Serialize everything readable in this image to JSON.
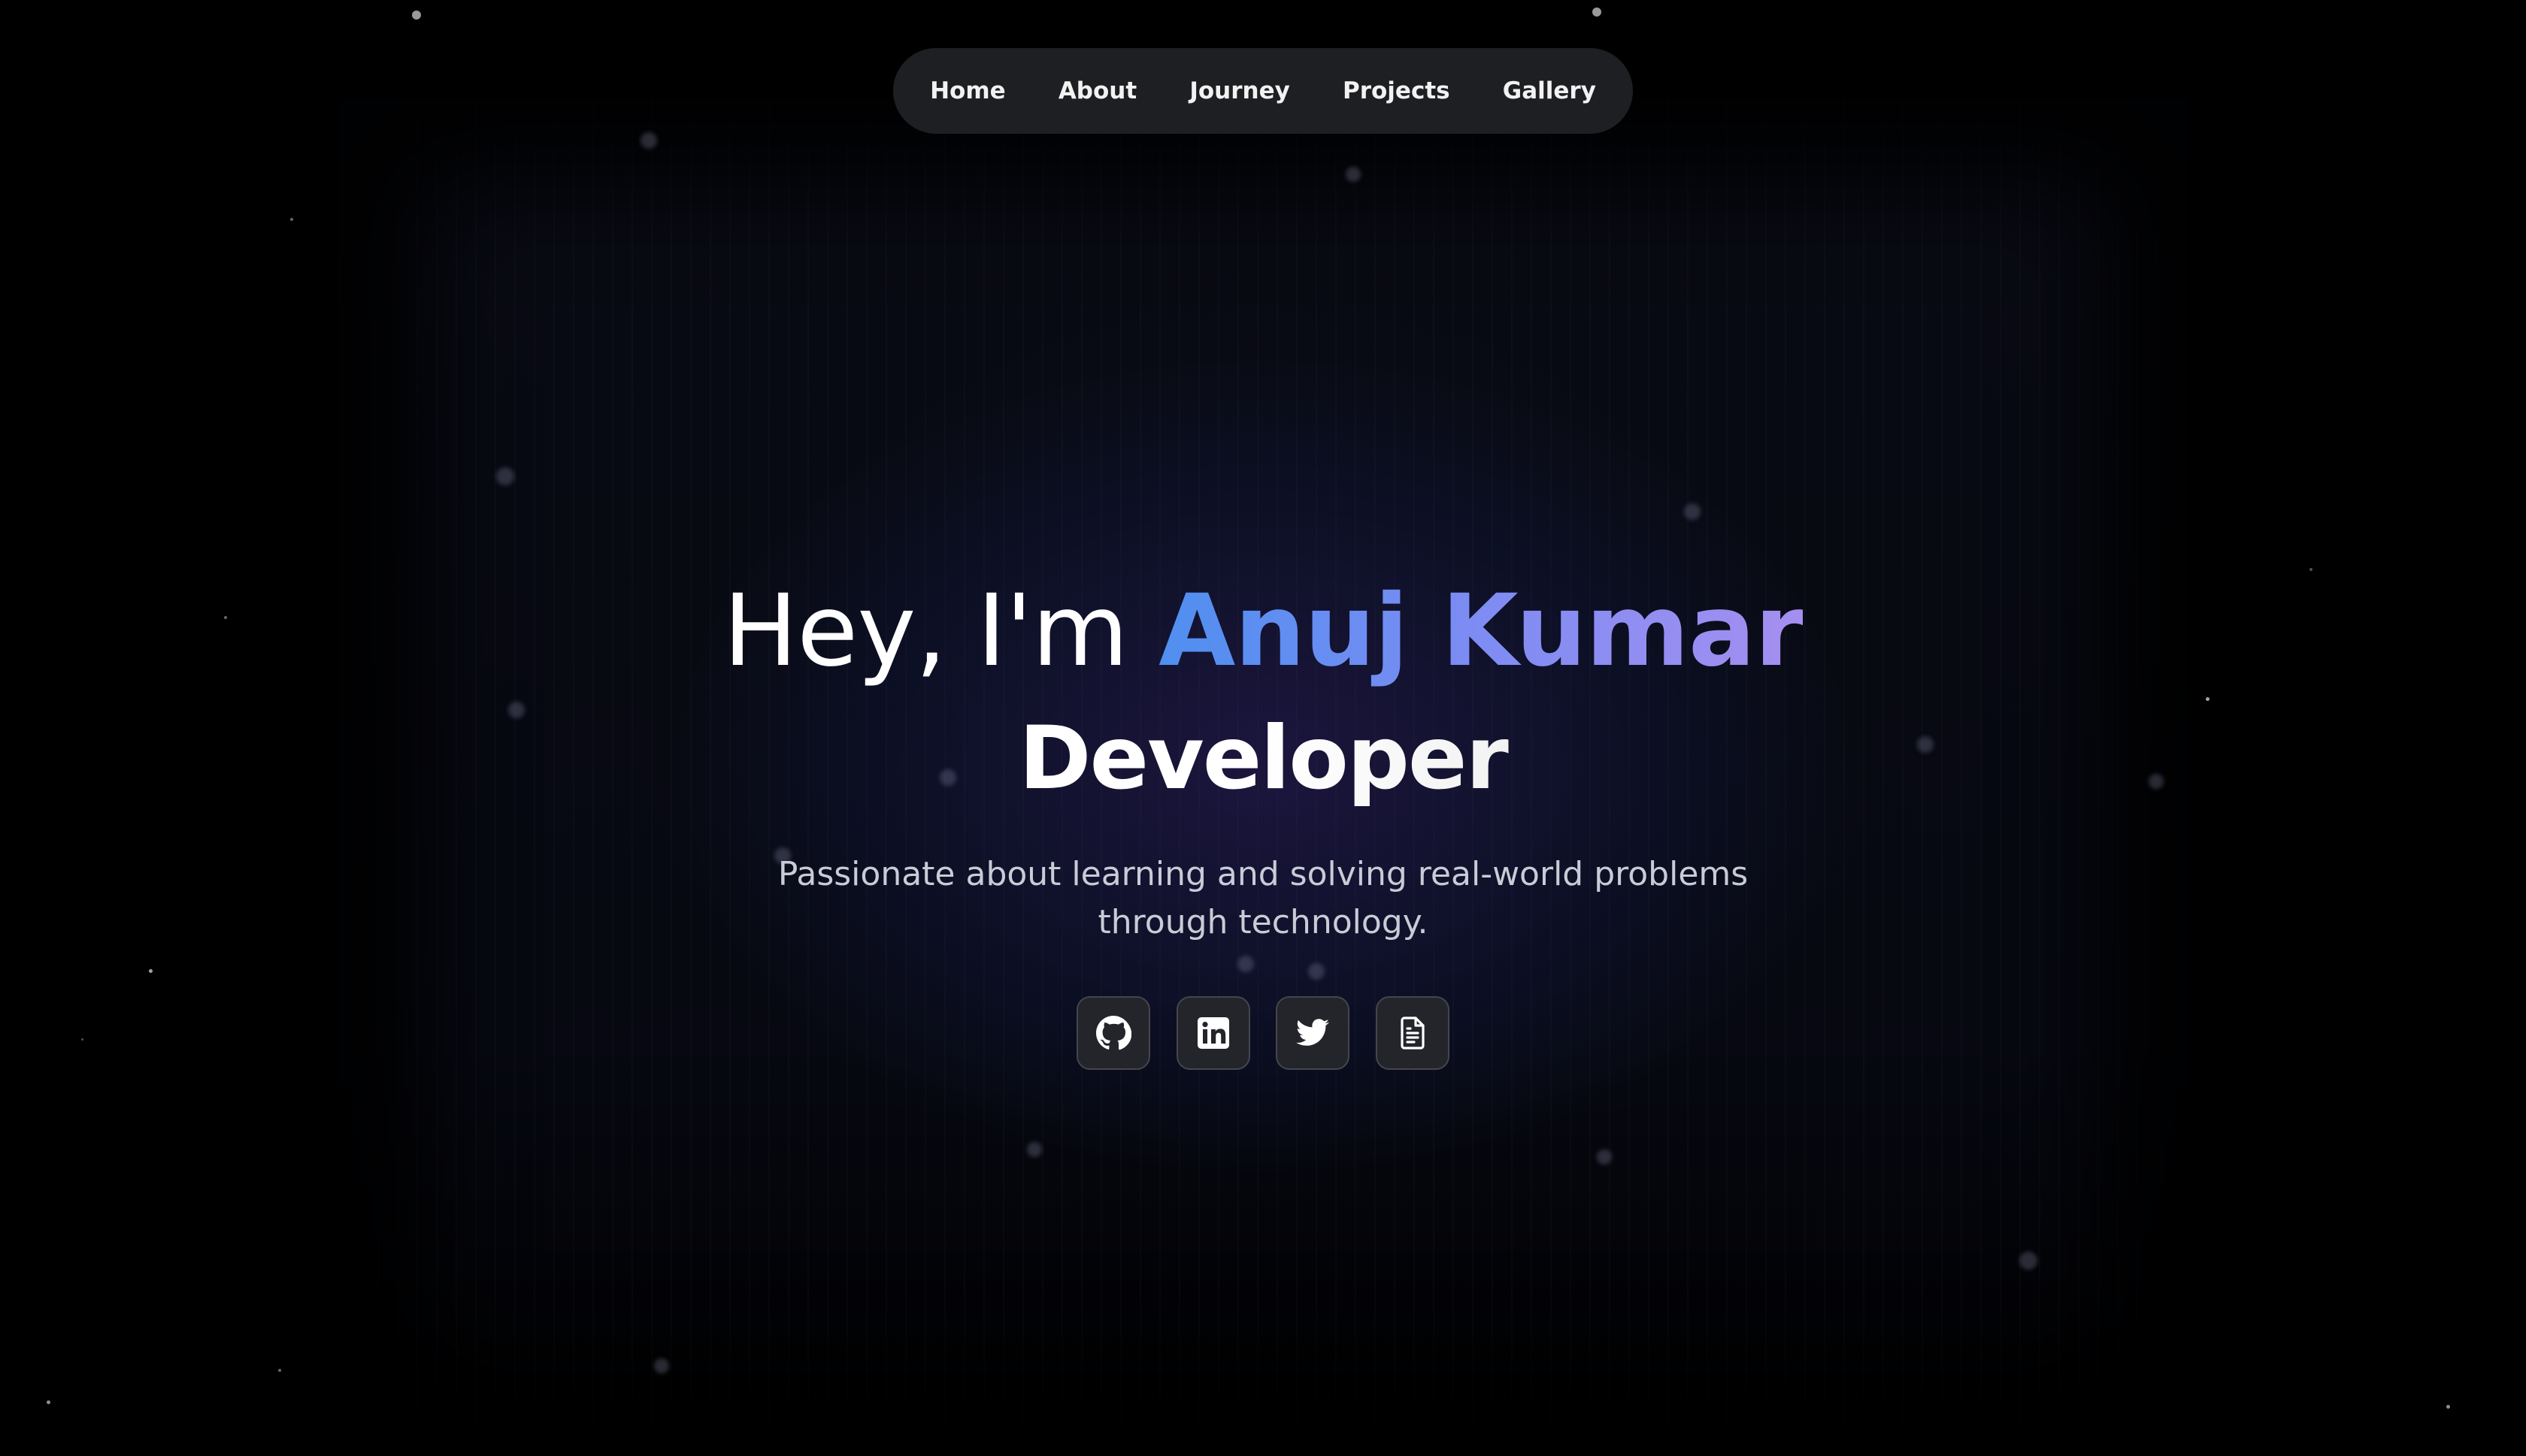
{
  "nav": {
    "items": [
      {
        "label": "Home"
      },
      {
        "label": "About"
      },
      {
        "label": "Journey"
      },
      {
        "label": "Projects"
      },
      {
        "label": "Gallery"
      }
    ]
  },
  "hero": {
    "greeting": "Hey, I'm ",
    "name": "Anuj Kumar",
    "role": "Developer",
    "tagline": "Passionate about learning and solving real-world problems through technology."
  },
  "social": {
    "links": [
      {
        "icon": "github-icon"
      },
      {
        "icon": "linkedin-icon"
      },
      {
        "icon": "twitter-icon"
      },
      {
        "icon": "resume-document-icon"
      }
    ]
  },
  "colors": {
    "background": "#000000",
    "nav_bg": "#1e1f22",
    "name_gradient_start": "#4f8ff0",
    "name_gradient_end": "#a58ff0",
    "button_bg": "#23252b"
  }
}
